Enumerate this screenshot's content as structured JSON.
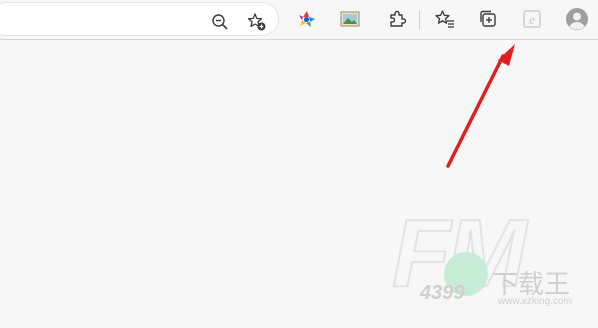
{
  "toolbar": {
    "address_value": "",
    "buttons": [
      {
        "name": "zoom-out-icon",
        "label": "Zoom out"
      },
      {
        "name": "add-favorite-icon",
        "label": "Add to favorites"
      },
      {
        "name": "extension-colorful-icon",
        "label": "Extension"
      },
      {
        "name": "image-extension-icon",
        "label": "Image extension"
      },
      {
        "name": "extensions-puzzle-icon",
        "label": "Extensions"
      },
      {
        "name": "favorites-icon",
        "label": "Favorites"
      },
      {
        "name": "collections-icon",
        "label": "Collections"
      },
      {
        "name": "ie-mode-icon",
        "label": "Internet Explorer mode"
      },
      {
        "name": "profile-avatar-icon",
        "label": "Profile"
      }
    ]
  },
  "annotation": {
    "color": "#e02020",
    "points_to": "ie-mode-icon"
  },
  "watermark": {
    "brand": "FM",
    "number": "4399",
    "site_cn": "下载王",
    "site_url": "www.xzking.com"
  },
  "colors": {
    "background": "#f7f7f7",
    "address_bar": "#ffffff",
    "icon": "#3b3b3b",
    "arrow": "#e02020"
  }
}
